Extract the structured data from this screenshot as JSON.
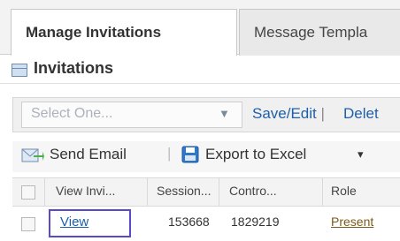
{
  "tabs": [
    {
      "label": "Manage Invitations"
    },
    {
      "label": "Message Templa"
    }
  ],
  "panel": {
    "title": "Invitations"
  },
  "toolbar": {
    "select_placeholder": "Select One...",
    "save_edit": "Save/Edit",
    "separator": "|",
    "delete": "Delet"
  },
  "actions": {
    "send_email": "Send Email",
    "separator": "|",
    "export": "Export to Excel",
    "export_caret": "▾"
  },
  "grid": {
    "headers": [
      "View Invi...",
      "Session...",
      "Contro...",
      "Role"
    ],
    "rows": [
      {
        "view": "View",
        "session": "153668",
        "control": "1829219",
        "role": "Present"
      }
    ]
  },
  "colors": {
    "accent": "#1f5fa8",
    "highlight_box": "#5a49c9"
  },
  "icons": [
    "grid-icon",
    "email-icon",
    "excel-save-icon",
    "chevron-down-icon"
  ]
}
